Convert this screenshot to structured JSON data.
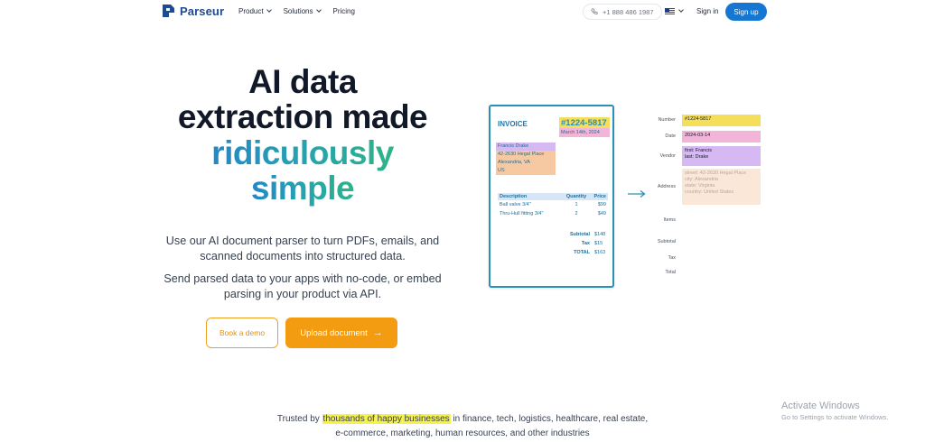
{
  "header": {
    "brand": "Parseur",
    "nav": [
      "Product",
      "Solutions",
      "Pricing"
    ],
    "phone": "+1 888 486 1987",
    "signin": "Sign in",
    "signup": "Sign up"
  },
  "hero": {
    "title_line1": "AI data",
    "title_line2": "extraction made",
    "title_line3": "ridiculously",
    "title_line4": "simple",
    "subtitle1": "Use our AI document parser to turn PDFs, emails, and scanned documents into structured data.",
    "subtitle2": "Send parsed data to your apps with no-code, or embed parsing in your product via API.",
    "demo_button": "Book a demo",
    "upload_button": "Upload document"
  },
  "invoice": {
    "title": "INVOICE",
    "number": "#1224-5817",
    "date": "March 14th, 2024",
    "address_name": "Francis Drake",
    "address_lines": [
      "42-2630 Hegal Place",
      "Alexandria, VA",
      "US"
    ],
    "headers": [
      "Description",
      "Quantity",
      "Price"
    ],
    "rows": [
      {
        "desc": "Ball valve 3/4\"",
        "qty": "1",
        "price": "$99"
      },
      {
        "desc": "Thru-Hull fitting 3/4\"",
        "qty": "2",
        "price": "$49"
      }
    ],
    "totals": [
      {
        "label": "Subtotal",
        "value": "$148"
      },
      {
        "label": "Tax",
        "value": "$15"
      },
      {
        "label": "TOTAL",
        "value": "$163"
      }
    ]
  },
  "extracted": {
    "labels": {
      "number": "Number",
      "date": "Date",
      "vendor": "Vendor",
      "address": "Address",
      "items": "Items",
      "subtotal": "Subtotal",
      "tax": "Tax",
      "total": "Total"
    },
    "number": "#1224-5817",
    "date": "2024-03-14",
    "vendor_first": "first: Francis",
    "vendor_last": "last: Drake",
    "address_lines": [
      "street: 42-2630 Hegal Place",
      "city: Alexandria",
      "state: Virginia",
      "country: United States"
    ]
  },
  "trusted": {
    "prefix": "Trusted by ",
    "highlight": "thousands of happy businesses",
    "suffix": " in finance, tech, logistics, healthcare, real estate,",
    "line2": "e-commerce, marketing, human resources, and other industries"
  },
  "watermark": {
    "title": "Activate Windows",
    "subtitle": "Go to Settings to activate Windows."
  },
  "colors": {
    "brand_blue": "#1677d2",
    "cta_orange": "#f39c12",
    "highlight_yellow": "#f5de5a",
    "highlight_pink": "#f2b4d7",
    "highlight_purple": "#d6b8f3"
  }
}
